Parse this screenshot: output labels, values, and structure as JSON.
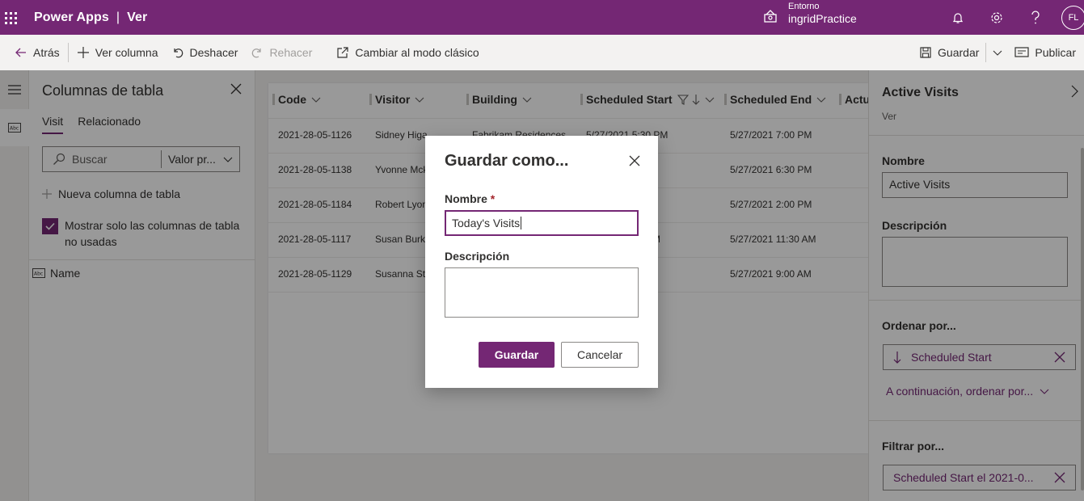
{
  "topbar": {
    "app_name": "Power Apps",
    "separator": "|",
    "page_name": "Ver",
    "env_label": "Entorno",
    "env_name": "ingridPractice",
    "avatar_initials": "FL"
  },
  "commands": {
    "back": "Atrás",
    "view_column": "Ver columna",
    "undo": "Deshacer",
    "redo": "Rehacer",
    "classic": "Cambiar al modo clásico",
    "save": "Guardar",
    "publish": "Publicar"
  },
  "columns_panel": {
    "title": "Columnas de tabla",
    "tabs": [
      "Visit",
      "Relacionado"
    ],
    "search_placeholder": "Buscar",
    "dropdown_value": "Valor pr...",
    "add_column": "Nueva columna de tabla",
    "checkbox_label": "Mostrar solo las columnas de tabla no usadas",
    "fields": [
      "Name"
    ]
  },
  "grid": {
    "headers": [
      "Code",
      "Visitor",
      "Building",
      "Scheduled Start",
      "Scheduled End",
      "Actu"
    ],
    "rows": [
      [
        "2021-28-05-1126",
        "Sidney Higa",
        "Fabrikam Residences",
        "5/27/2021 5:30 PM",
        "5/27/2021 7:00 PM"
      ],
      [
        "2021-28-05-1138",
        "Yvonne Mck",
        "",
        "M",
        "5/27/2021 6:30 PM"
      ],
      [
        "2021-28-05-1184",
        "Robert Lyon",
        "",
        "M",
        "5/27/2021 2:00 PM"
      ],
      [
        "2021-28-05-1117",
        "Susan Burk",
        "",
        "AM",
        "5/27/2021 11:30 AM"
      ],
      [
        "2021-28-05-1129",
        "Susanna Stu",
        "",
        "M",
        "5/27/2021 9:00 AM"
      ]
    ]
  },
  "right_panel": {
    "title": "Active Visits",
    "subtitle": "Ver",
    "name_label": "Nombre",
    "name_value": "Active Visits",
    "desc_label": "Descripción",
    "sort_label": "Ordenar por...",
    "sort_value": "Scheduled Start",
    "then_sort": "A continuación, ordenar por...",
    "filter_label": "Filtrar por...",
    "filter_value": "Scheduled Start el 2021-0..."
  },
  "dialog": {
    "title": "Guardar como...",
    "name_label": "Nombre",
    "required_mark": "*",
    "name_value": "Today's Visits",
    "desc_label": "Descripción",
    "save_button": "Guardar",
    "cancel_button": "Cancelar"
  },
  "colors": {
    "brand": "#742774",
    "overlay": "rgba(0,0,0,0.4)"
  }
}
